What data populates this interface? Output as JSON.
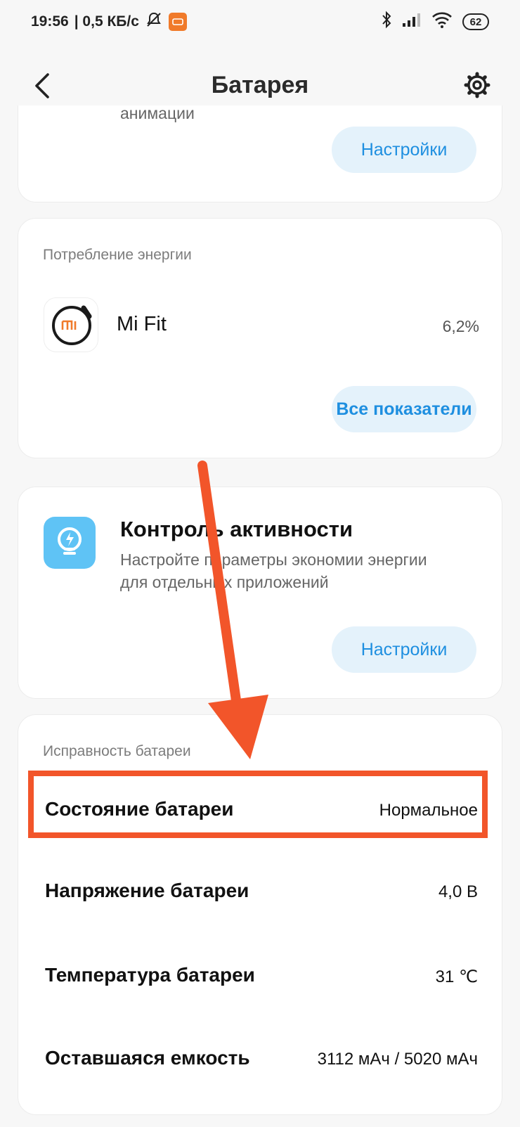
{
  "status_bar": {
    "time": "19:56",
    "speed": "| 0,5 КБ/с",
    "battery_level": "62"
  },
  "header": {
    "title": "Батарея"
  },
  "animation_card": {
    "partial_text": "анимации",
    "button_label": "Настройки"
  },
  "energy_card": {
    "section_label": "Потребление энергии",
    "app_name": "Mi Fit",
    "app_percent": "6,2%",
    "button_label": "Все показатели"
  },
  "activity_card": {
    "title": "Контроль активности",
    "description_line1": "Настройте параметры экономии энергии",
    "description_line2": "для отдельных приложений",
    "button_label": "Настройки"
  },
  "health_card": {
    "section_label": "Исправность батареи",
    "rows": [
      {
        "label": "Состояние батареи",
        "value": "Нормальное"
      },
      {
        "label": "Напряжение батареи",
        "value": "4,0 В"
      },
      {
        "label": "Температура батареи",
        "value": "31 ℃"
      },
      {
        "label": "Оставшаяся емкость",
        "value": "3112 мАч / 5020 мАч"
      }
    ]
  },
  "colors": {
    "accent": "#1e8fe0",
    "button_bg": "#e4f2fb",
    "annotation": "#f2552a",
    "activity_icon": "#5fc3f5"
  }
}
